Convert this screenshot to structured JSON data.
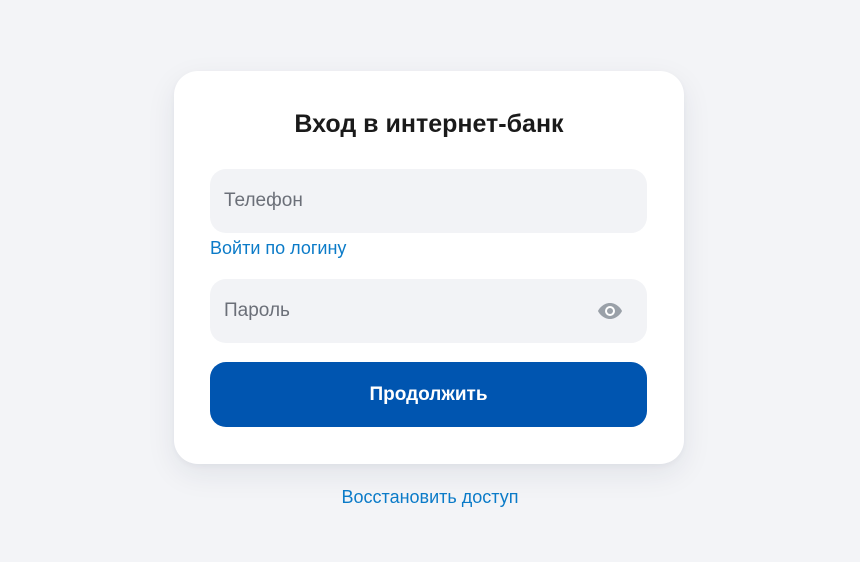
{
  "login_card": {
    "title": "Вход в интернет-банк",
    "phone_field": {
      "placeholder": "Телефон",
      "value": ""
    },
    "login_by_username_link": "Войти по логину",
    "password_field": {
      "placeholder": "Пароль",
      "value": "",
      "toggle_icon": "eye-icon"
    },
    "continue_button": "Продолжить"
  },
  "restore_access_link": "Восстановить доступ",
  "colors": {
    "page_background": "#f3f4f7",
    "card_background": "#ffffff",
    "field_background": "#f2f3f6",
    "link": "#0b7bc8",
    "primary_button": "#0055b0",
    "icon_gray": "#9aa0a8"
  }
}
